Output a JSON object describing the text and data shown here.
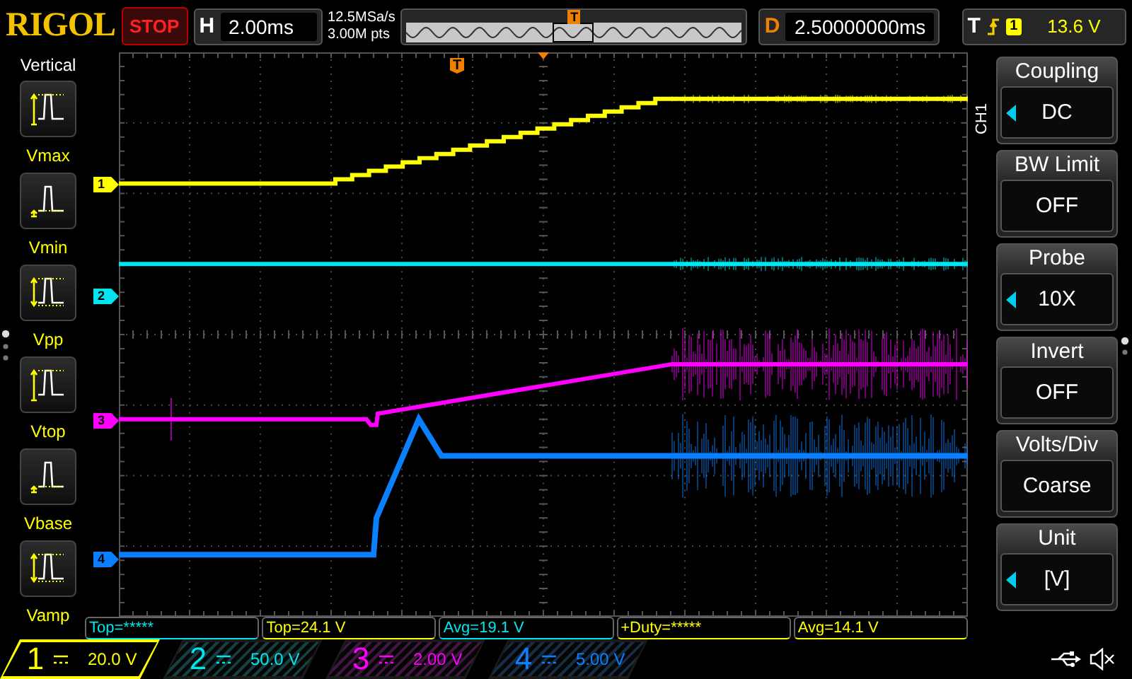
{
  "header": {
    "brand": "RIGOL",
    "run_state": "STOP",
    "timebase": {
      "label": "H",
      "value": "2.00ms"
    },
    "sample_rate": "12.5MSa/s",
    "memory_depth": "3.00M pts",
    "overview": {
      "trigger_marker": "T"
    },
    "delay": {
      "label": "D",
      "value": "2.50000000ms"
    },
    "trigger": {
      "label": "T",
      "source": "1",
      "level": "13.6 V"
    }
  },
  "left_menu": {
    "title": "Vertical",
    "items": [
      {
        "label": "Vmax",
        "kind": "up"
      },
      {
        "label": "Vmin",
        "kind": "base"
      },
      {
        "label": "Vpp",
        "kind": "double"
      },
      {
        "label": "Vtop",
        "kind": "up"
      },
      {
        "label": "Vbase",
        "kind": "base"
      },
      {
        "label": "Vamp",
        "kind": "double"
      }
    ]
  },
  "waveform": {
    "trigger_marker": "T",
    "channels": [
      {
        "marker": "1",
        "color": "#ffff00"
      },
      {
        "marker": "2",
        "color": "#00e5ee"
      },
      {
        "marker": "3",
        "color": "#ff00ff"
      },
      {
        "marker": "4",
        "color": "#0a80ff"
      }
    ]
  },
  "right_menu": {
    "channel": "CH1",
    "items": [
      {
        "title": "Coupling",
        "value": "DC",
        "adjustable": true
      },
      {
        "title": "BW Limit",
        "value": "OFF",
        "adjustable": false
      },
      {
        "title": "Probe",
        "value": "10X",
        "adjustable": true
      },
      {
        "title": "Invert",
        "value": "OFF",
        "adjustable": false
      },
      {
        "title": "Volts/Div",
        "value": "Coarse",
        "adjustable": false
      },
      {
        "title": "Unit",
        "value": "[V]",
        "adjustable": true
      }
    ]
  },
  "measurements": [
    {
      "text": "Top=*****",
      "color": "#00e5ee"
    },
    {
      "text": "Top=24.1 V",
      "color": "#ffff00"
    },
    {
      "text": "Avg=19.1 V",
      "color": "#00e5ee"
    },
    {
      "text": "+Duty=*****",
      "color": "#ffff00"
    },
    {
      "text": "Avg=14.1 V",
      "color": "#ffff00"
    }
  ],
  "channels": [
    {
      "number": "1",
      "scale": "20.0 V",
      "color": "#ffff00",
      "selected": true
    },
    {
      "number": "2",
      "scale": "50.0 V",
      "color": "#00e5ee",
      "selected": false
    },
    {
      "number": "3",
      "scale": "2.00 V",
      "color": "#ff00ff",
      "selected": false
    },
    {
      "number": "4",
      "scale": "5.00 V",
      "color": "#0a80ff",
      "selected": false
    }
  ]
}
